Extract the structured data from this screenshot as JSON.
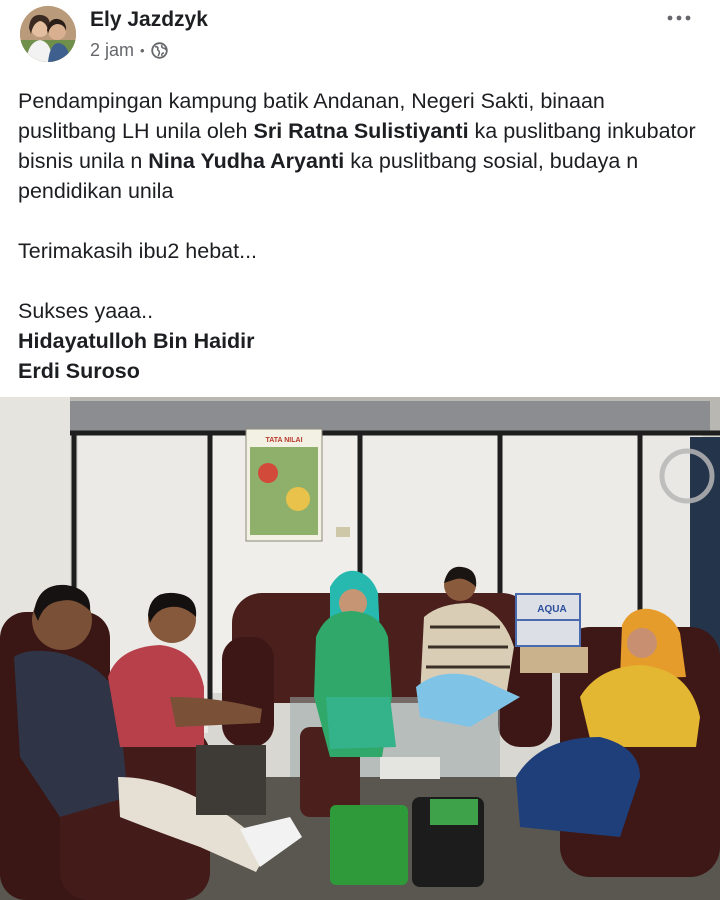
{
  "post": {
    "author": "Ely Jazdzyk",
    "time": "2 jam",
    "separator": "•",
    "audience_icon": "globe-icon",
    "more_icon": "more-dots-icon",
    "body": {
      "p1": {
        "t1": "Pendampingan kampung batik Andanan, Negeri Sakti, binaan puslitbang LH unila  oleh ",
        "b1": "Sri Ratna Sulistiyanti",
        "t2": " ka puslitbang inkubator bisnis unila n ",
        "b2": "Nina Yudha Aryanti",
        "t3": " ka puslitbang sosial, budaya n pendidikan unila"
      },
      "p2": "Terimakasih ibu2 hebat...",
      "p3": "Sukses yaaa..",
      "tag1": "Hidayatulloh Bin Haidir",
      "tag2": "Erdi Suroso"
    },
    "photo": {
      "poster_text": "TATA NILAI",
      "box_label": "AQUA"
    }
  }
}
